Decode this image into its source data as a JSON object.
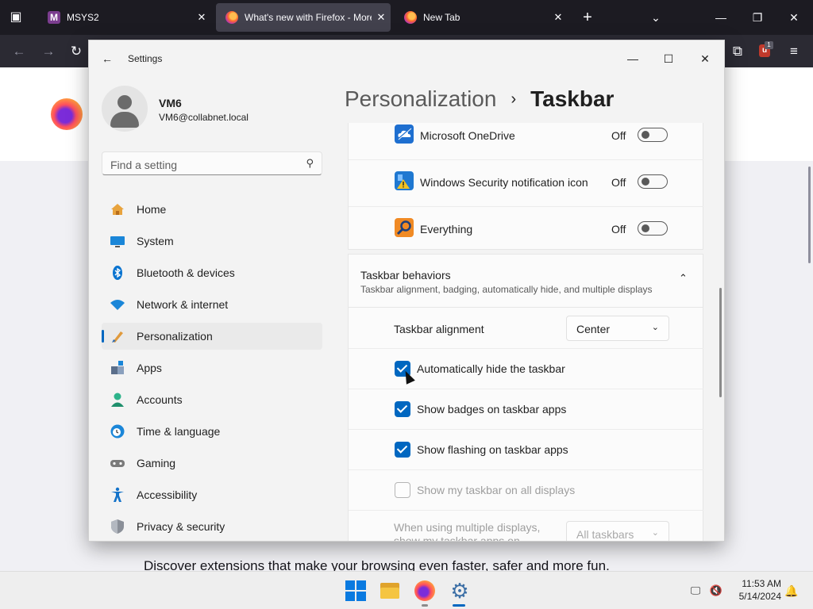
{
  "browser": {
    "tabs": [
      {
        "title": "MSYS2",
        "favicon": "msys2-logo-icon",
        "active": false
      },
      {
        "title": "What's new with Firefox - More",
        "favicon": "firefox-icon",
        "active": true
      },
      {
        "title": "New Tab",
        "favicon": "firefox-icon",
        "active": false
      }
    ],
    "extension_badge_count": "1",
    "page_tagline": "Discover extensions that make your browsing even faster, safer and more fun.",
    "colors": {
      "tabbar": "#1c1b22",
      "toolbar": "#2b2a33",
      "active_tab": "#42414d"
    }
  },
  "settings": {
    "window_title": "Settings",
    "user": {
      "name": "VM6",
      "email": "VM6@collabnet.local"
    },
    "search_placeholder": "Find a setting",
    "nav": [
      {
        "label": "Home",
        "icon": "home-icon",
        "selected": false
      },
      {
        "label": "System",
        "icon": "system-display-icon",
        "selected": false
      },
      {
        "label": "Bluetooth & devices",
        "icon": "bluetooth-icon",
        "selected": false
      },
      {
        "label": "Network & internet",
        "icon": "wifi-icon",
        "selected": false
      },
      {
        "label": "Personalization",
        "icon": "paintbrush-icon",
        "selected": true
      },
      {
        "label": "Apps",
        "icon": "apps-icon",
        "selected": false
      },
      {
        "label": "Accounts",
        "icon": "account-icon",
        "selected": false
      },
      {
        "label": "Time & language",
        "icon": "clock-globe-icon",
        "selected": false
      },
      {
        "label": "Gaming",
        "icon": "gamepad-icon",
        "selected": false
      },
      {
        "label": "Accessibility",
        "icon": "accessibility-icon",
        "selected": false
      },
      {
        "label": "Privacy & security",
        "icon": "shield-icon",
        "selected": false
      }
    ],
    "breadcrumb": {
      "parent": "Personalization",
      "separator": "›",
      "current": "Taskbar"
    },
    "tray_apps": [
      {
        "label": "Microsoft OneDrive",
        "icon": "onedrive-icon",
        "state": "Off"
      },
      {
        "label": "Windows Security notification icon",
        "icon": "windows-security-icon",
        "state": "Off"
      },
      {
        "label": "Everything",
        "icon": "everything-search-icon",
        "state": "Off"
      }
    ],
    "behaviors": {
      "title": "Taskbar behaviors",
      "subtitle": "Taskbar alignment, badging, automatically hide, and multiple displays",
      "alignment_label": "Taskbar alignment",
      "alignment_value": "Center",
      "checkboxes": [
        {
          "label": "Automatically hide the taskbar",
          "checked": true,
          "enabled": true
        },
        {
          "label": "Show badges on taskbar apps",
          "checked": true,
          "enabled": true
        },
        {
          "label": "Show flashing on taskbar apps",
          "checked": true,
          "enabled": true
        },
        {
          "label": "Show my taskbar on all displays",
          "checked": false,
          "enabled": false
        }
      ],
      "multi_display_label": "When using multiple displays, show my taskbar apps on",
      "multi_display_value": "All taskbars"
    },
    "accent_color": "#0067c0"
  },
  "taskbar": {
    "time": "11:53 AM",
    "date": "5/14/2024",
    "apps": [
      "windows-start-icon",
      "file-explorer-icon",
      "firefox-icon",
      "settings-gear-icon"
    ]
  }
}
